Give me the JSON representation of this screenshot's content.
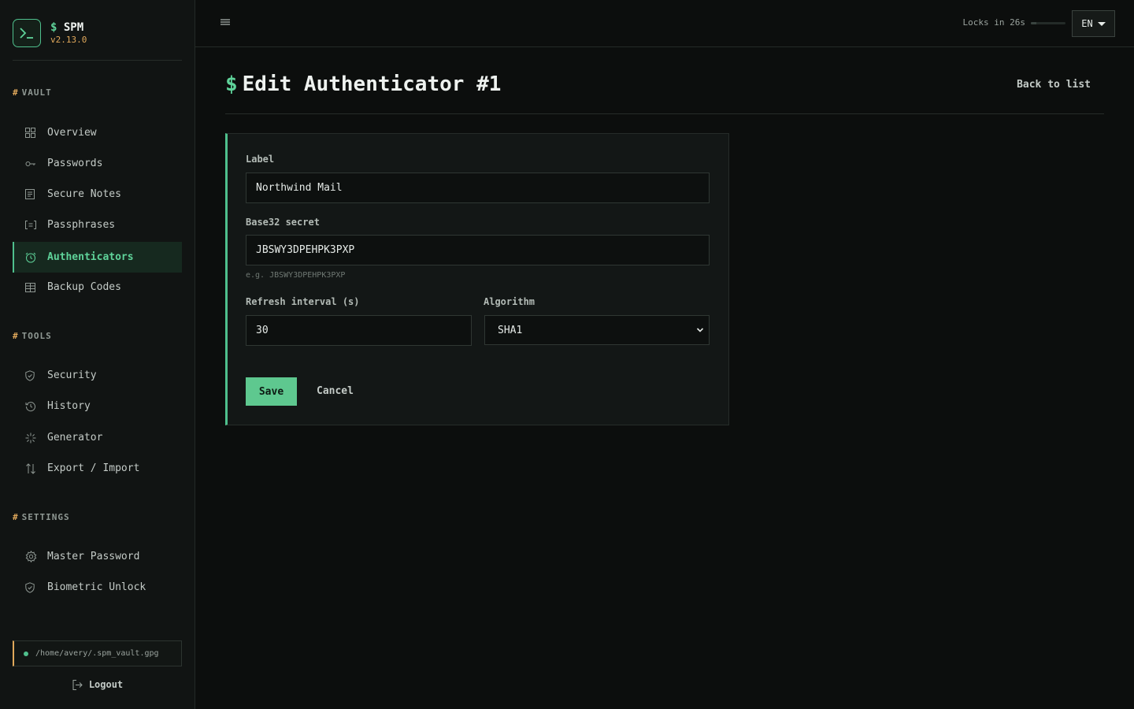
{
  "brand": {
    "prompt": "$",
    "name": "SPM",
    "version": "v2.13.0"
  },
  "sidebar": {
    "sections": [
      {
        "title": "VAULT",
        "items": [
          {
            "label": "Overview",
            "icon": "grid-icon"
          },
          {
            "label": "Passwords",
            "icon": "key-icon"
          },
          {
            "label": "Secure Notes",
            "icon": "note-icon"
          },
          {
            "label": "Passphrases",
            "icon": "bracket-icon"
          },
          {
            "label": "Authenticators",
            "icon": "clock-icon",
            "active": true
          },
          {
            "label": "Backup Codes",
            "icon": "table-icon"
          }
        ]
      },
      {
        "title": "TOOLS",
        "items": [
          {
            "label": "Security",
            "icon": "shield-icon"
          },
          {
            "label": "History",
            "icon": "history-icon"
          },
          {
            "label": "Generator",
            "icon": "sparkle-icon"
          },
          {
            "label": "Export / Import",
            "icon": "arrows-icon"
          }
        ]
      },
      {
        "title": "SETTINGS",
        "items": [
          {
            "label": "Master Password",
            "icon": "gear-icon"
          },
          {
            "label": "Biometric Unlock",
            "icon": "shield-icon"
          }
        ]
      }
    ],
    "vault_path": "/home/avery/.spm_vault.gpg",
    "logout_label": "Logout"
  },
  "topbar": {
    "lock_text": "Locks in 26s",
    "lock_progress": 0.15,
    "language": "EN"
  },
  "page": {
    "prompt": "$",
    "title": "Edit Authenticator #1",
    "back_label": "Back to list"
  },
  "form": {
    "label_field": {
      "label": "Label",
      "value": "Northwind Mail"
    },
    "secret_field": {
      "label": "Base32 secret",
      "value": "JBSWY3DPEHPK3PXP",
      "hint": "e.g. JBSWY3DPEHPK3PXP"
    },
    "interval_field": {
      "label": "Refresh interval (s)",
      "value": "30"
    },
    "algorithm_field": {
      "label": "Algorithm",
      "value": "SHA1"
    },
    "save_label": "Save",
    "cancel_label": "Cancel"
  },
  "colors": {
    "accent": "#5ec88f",
    "warning": "#e0a85b",
    "background": "#0c0e0d"
  }
}
